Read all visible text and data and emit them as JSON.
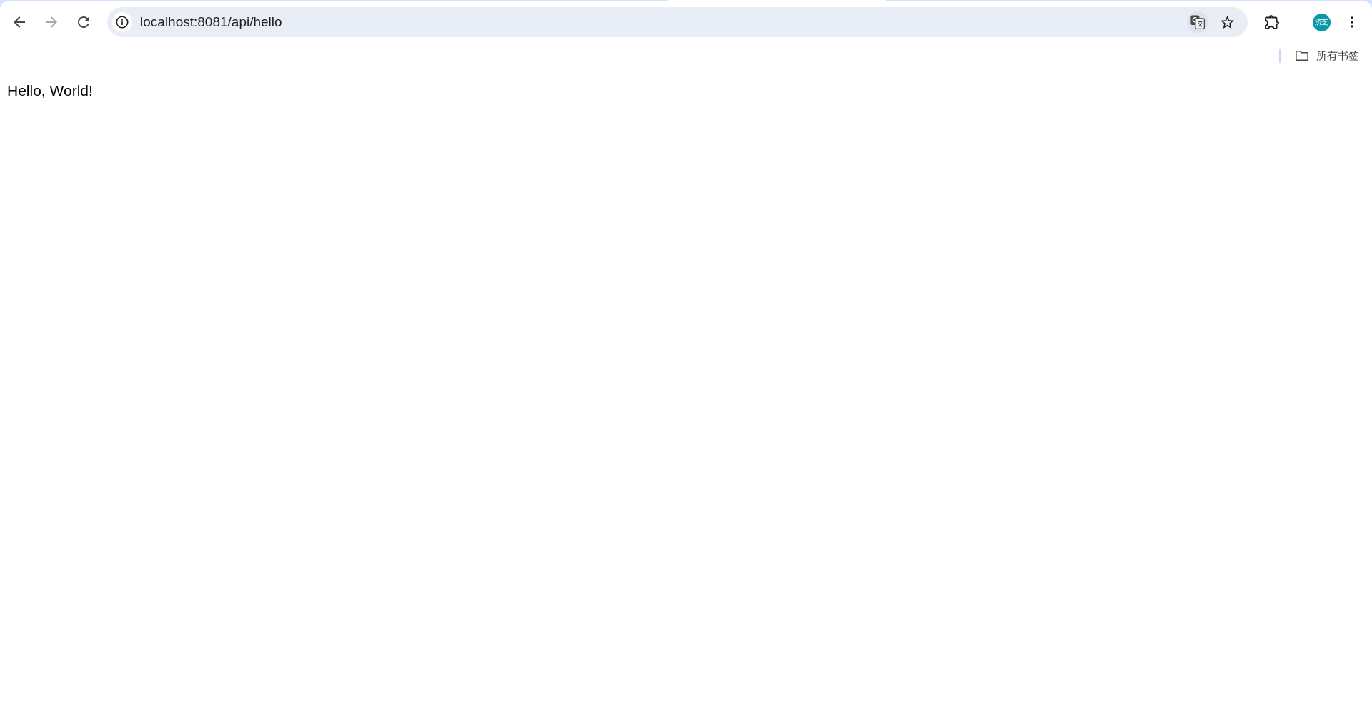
{
  "toolbar": {
    "nav_buttons": [
      {
        "kind": "back",
        "disabled": false
      },
      {
        "kind": "forward",
        "disabled": true
      },
      {
        "kind": "reload",
        "disabled": false
      }
    ],
    "address_bar": {
      "url": "localhost:8081/api/hello"
    },
    "profile": {
      "label": "济芝"
    }
  },
  "bookmarks_bar": {
    "items": [
      {
        "label": "所有书签"
      }
    ]
  },
  "page": {
    "text": "Hello, World!"
  }
}
